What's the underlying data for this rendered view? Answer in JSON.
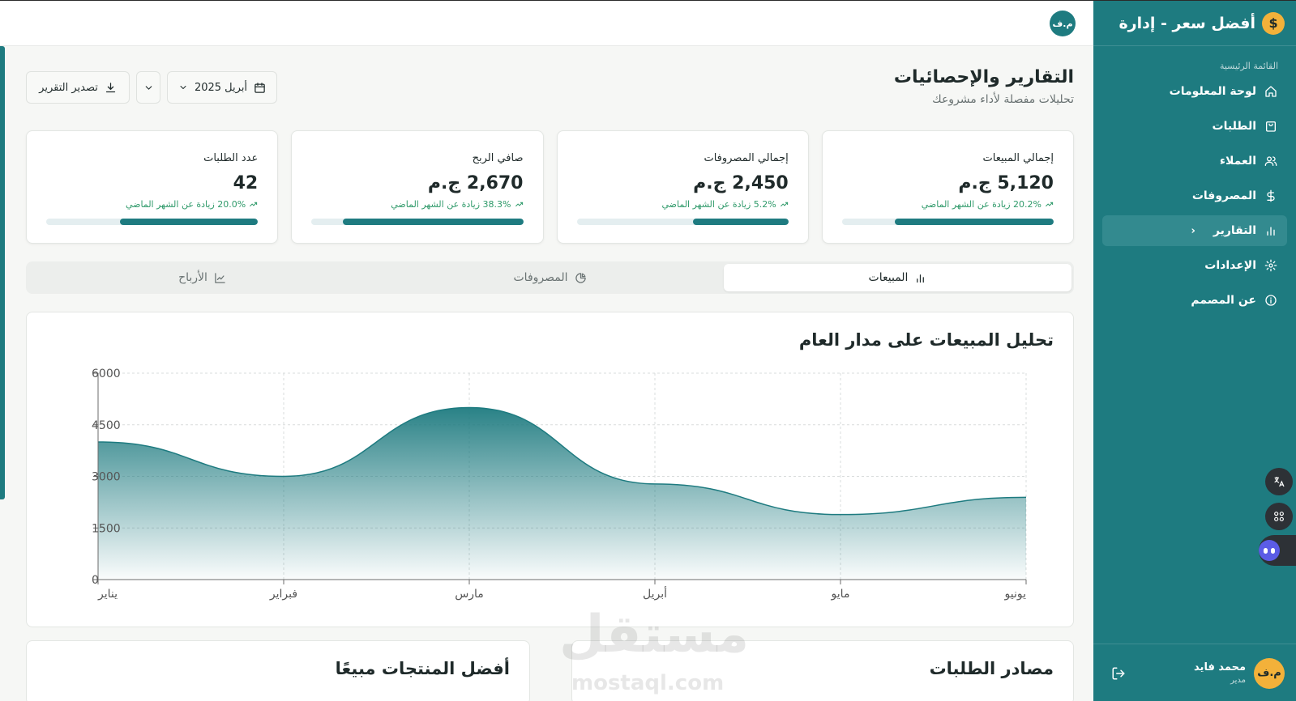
{
  "brand": {
    "title": "أفضل سعر - إدارة",
    "coin_symbol": "$",
    "accent": "#f3b13a"
  },
  "sidebar": {
    "section_label": "القائمة الرئيسية",
    "items": [
      {
        "label": "لوحة المعلومات",
        "icon": "home-icon"
      },
      {
        "label": "الطلبات",
        "icon": "shopping-bag-icon"
      },
      {
        "label": "العملاء",
        "icon": "users-icon"
      },
      {
        "label": "المصروفات",
        "icon": "dollar-icon"
      },
      {
        "label": "التقارير",
        "icon": "bar-chart-icon",
        "active": true
      },
      {
        "label": "الإعدادات",
        "icon": "gear-icon"
      },
      {
        "label": "عن المصمم",
        "icon": "info-icon"
      }
    ],
    "user": {
      "initials": "م.ف",
      "name": "محمد فايد",
      "role": "مدير"
    }
  },
  "topbar": {
    "avatar_initials": "م.ف"
  },
  "header": {
    "title": "التقارير والإحصائيات",
    "subtitle": "تحليلات مفصلة لأداء مشروعك",
    "period_label": "أبريل 2025",
    "export_label": "تصدير التقرير"
  },
  "cards": [
    {
      "label": "إجمالي المبيعات",
      "value": "5,120 ج.م",
      "trend": "20.2% زيادة عن الشهر الماضي",
      "progress": 0.75
    },
    {
      "label": "إجمالي المصروفات",
      "value": "2,450 ج.م",
      "trend": "5.2% زيادة عن الشهر الماضي",
      "progress": 0.45
    },
    {
      "label": "صافي الربح",
      "value": "2,670 ج.م",
      "trend": "38.3% زيادة عن الشهر الماضي",
      "progress": 0.85
    },
    {
      "label": "عدد الطلبات",
      "value": "42",
      "trend": "20.0% زيادة عن الشهر الماضي",
      "progress": 0.65
    }
  ],
  "tabs": [
    {
      "label": "المبيعات",
      "icon": "bar-chart-icon",
      "active": true
    },
    {
      "label": "المصروفات",
      "icon": "pie-chart-icon"
    },
    {
      "label": "الأرباح",
      "icon": "line-chart-icon"
    }
  ],
  "chart_data": {
    "type": "area",
    "title": "تحليل المبيعات على مدار العام",
    "categories": [
      "يناير",
      "فبراير",
      "مارس",
      "أبريل",
      "مايو",
      "يونيو"
    ],
    "values": [
      4000,
      3000,
      5000,
      2780,
      1890,
      2390
    ],
    "ylim": [
      0,
      6000
    ],
    "yticks": [
      0,
      1500,
      3000,
      4500,
      6000
    ],
    "grid": true,
    "color": "#1e7b80"
  },
  "bottom": {
    "left_title": "أفضل المنتجات مبيعًا",
    "right_title": "مصادر الطلبات"
  },
  "watermark": {
    "text": "مستقل",
    "sub": "mostaql.com"
  }
}
